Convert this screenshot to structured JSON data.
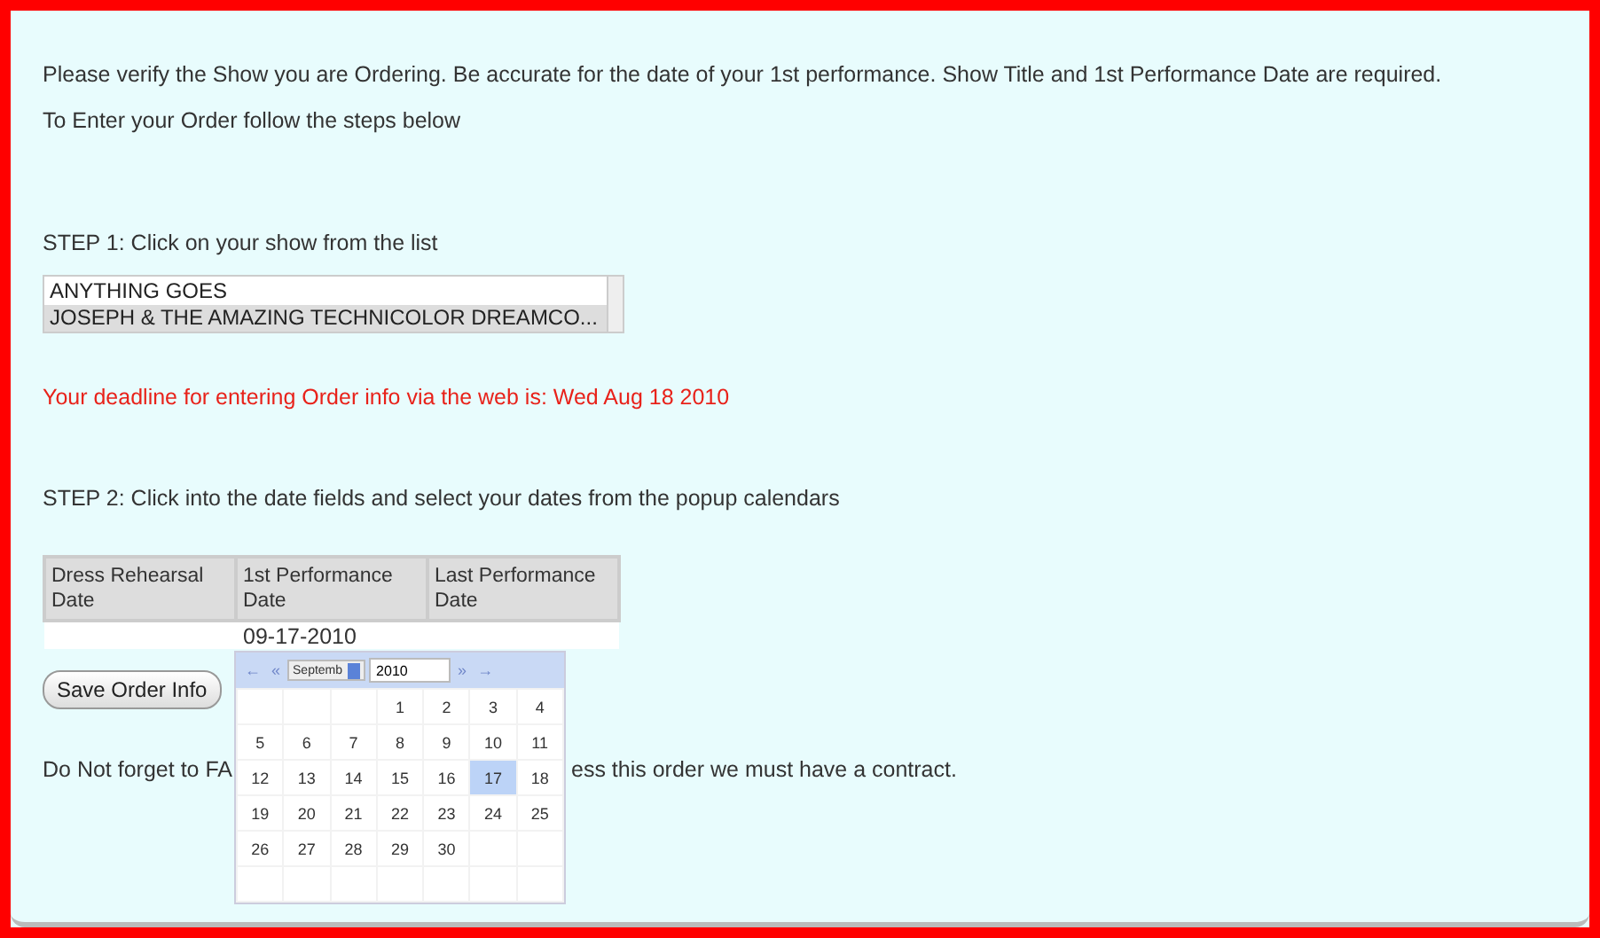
{
  "intro": [
    "Please verify the Show you are Ordering. Be accurate for the date of your 1st performance. Show Title and 1st Performance Date are required.",
    "To Enter your Order follow the steps below"
  ],
  "step1": {
    "label": "STEP 1: Click on your show from the list",
    "shows": [
      {
        "title": "ANYTHING GOES",
        "selected": false
      },
      {
        "title": "JOSEPH & THE AMAZING TECHNICOLOR DREAMCO...",
        "selected": true
      }
    ]
  },
  "deadline": "Your deadline for entering Order info via the web is: Wed Aug 18 2010",
  "step2": {
    "label": "STEP 2: Click into the date fields and select your dates from the popup calendars",
    "columns": [
      {
        "header": "Dress Rehearsal Date"
      },
      {
        "header": "1st Performance Date",
        "value": "09-17-2010"
      },
      {
        "header": "Last Performance Date"
      }
    ]
  },
  "calendar": {
    "prev_year": "←",
    "prev_month": "«",
    "month": "Septemb",
    "year": "2010",
    "next_month": "»",
    "next_year": "→",
    "weeks": [
      {
        "kind": "first",
        "days": [
          {
            "day": "1",
            "selected": false
          },
          {
            "day": "2",
            "selected": false
          },
          {
            "day": "3",
            "selected": false
          },
          {
            "day": "4",
            "selected": false
          }
        ]
      },
      {
        "kind": "full",
        "days": [
          {
            "day": "5",
            "selected": false
          },
          {
            "day": "6",
            "selected": false
          },
          {
            "day": "7",
            "selected": false
          },
          {
            "day": "8",
            "selected": false
          },
          {
            "day": "9",
            "selected": false
          },
          {
            "day": "10",
            "selected": false
          },
          {
            "day": "11",
            "selected": false
          }
        ]
      },
      {
        "kind": "full",
        "days": [
          {
            "day": "12",
            "selected": false
          },
          {
            "day": "13",
            "selected": false
          },
          {
            "day": "14",
            "selected": false
          },
          {
            "day": "15",
            "selected": false
          },
          {
            "day": "16",
            "selected": false
          },
          {
            "day": "17",
            "selected": true
          },
          {
            "day": "18",
            "selected": false
          }
        ]
      },
      {
        "kind": "full",
        "days": [
          {
            "day": "19",
            "selected": false
          },
          {
            "day": "20",
            "selected": false
          },
          {
            "day": "21",
            "selected": false
          },
          {
            "day": "22",
            "selected": false
          },
          {
            "day": "23",
            "selected": false
          },
          {
            "day": "24",
            "selected": false
          },
          {
            "day": "25",
            "selected": false
          }
        ]
      },
      {
        "kind": "last",
        "days": [
          {
            "day": "26",
            "selected": false
          },
          {
            "day": "27",
            "selected": false
          },
          {
            "day": "28",
            "selected": false
          },
          {
            "day": "29",
            "selected": false
          },
          {
            "day": "30",
            "selected": false
          }
        ]
      }
    ]
  },
  "save_button": "Save Order Info",
  "reminder": [
    "Do Not forget to FA",
    "ess this order we must have a contract."
  ]
}
